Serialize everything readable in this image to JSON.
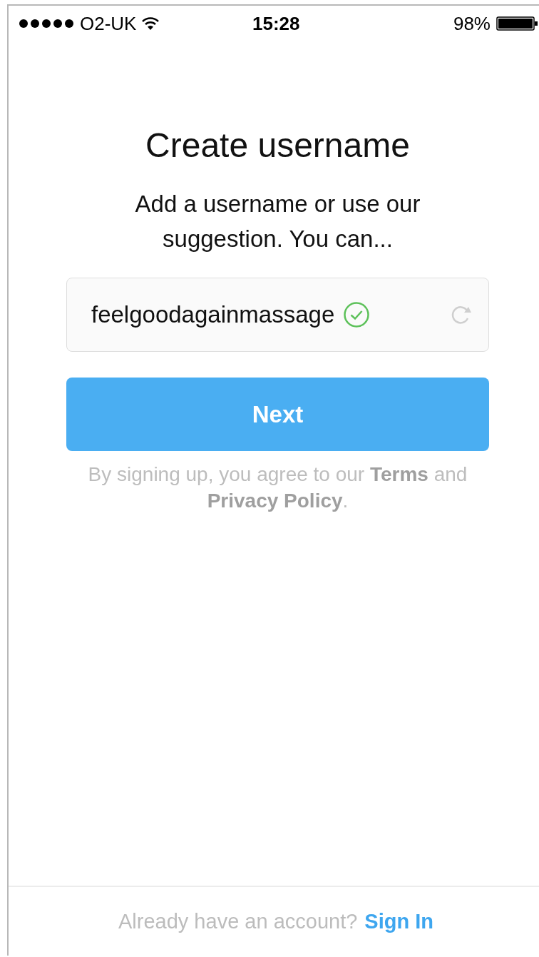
{
  "status_bar": {
    "carrier": "O2-UK",
    "time": "15:28",
    "battery": "98%"
  },
  "title": "Create username",
  "subtitle": "Add a username or use our suggestion. You can...",
  "username_field": {
    "value": "feelgoodagainmassage",
    "valid": true
  },
  "next_button": {
    "label": "Next"
  },
  "legal": "By signing up, you agree to our **Terms** and **Privacy Policy**.",
  "footer": {
    "text": "Already have an account?",
    "link": "Sign In"
  }
}
